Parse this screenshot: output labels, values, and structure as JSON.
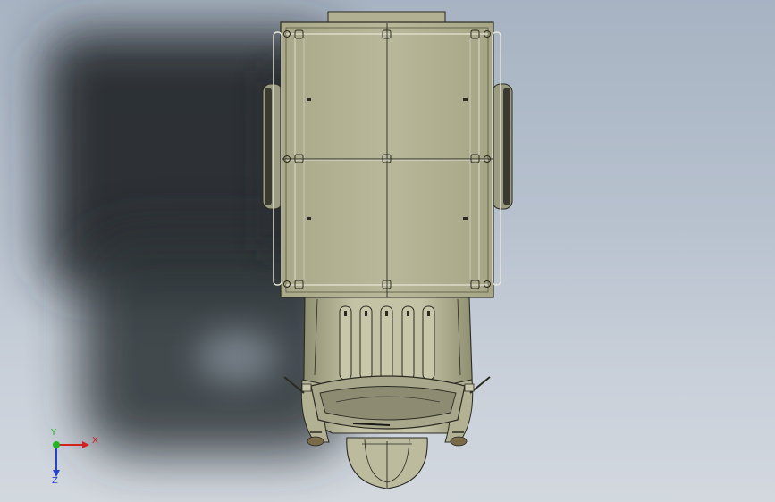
{
  "viewport": {
    "background_top": "#a7b3c2",
    "background_bottom": "#d3d8df"
  },
  "model": {
    "body_color": "#b6b596",
    "edge_color": "#2a2a22",
    "shadow_color": "#262a2e"
  },
  "triad": {
    "x_label": "X",
    "y_label": "Y",
    "z_label": "Z",
    "x_color": "#d32020",
    "y_color": "#22b422",
    "z_color": "#2244cc"
  }
}
